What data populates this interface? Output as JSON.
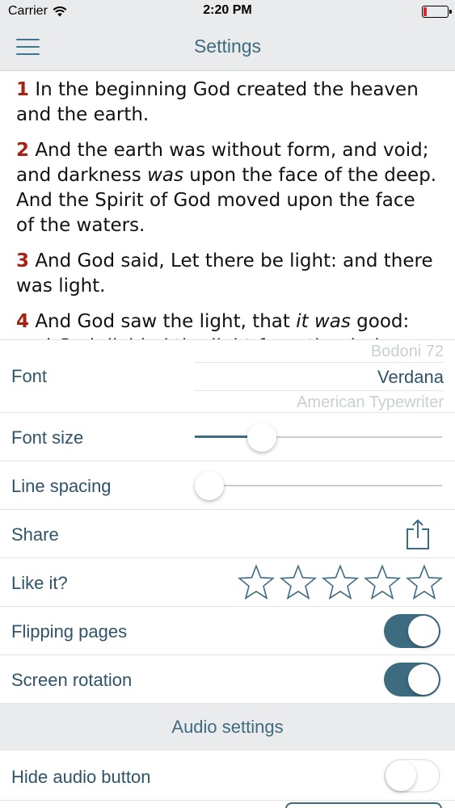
{
  "status_bar": {
    "carrier": "Carrier",
    "time": "2:20 PM",
    "battery_color": "#e0242b"
  },
  "nav": {
    "title": "Settings",
    "menu_icon": "hamburger-menu-icon"
  },
  "preview": {
    "verses": [
      {
        "num": "1",
        "parts": [
          {
            "t": "In the beginning God created the heaven and the earth."
          }
        ]
      },
      {
        "num": "2",
        "parts": [
          {
            "t": "And the earth was without form, and void; and darkness "
          },
          {
            "t": "was",
            "i": true
          },
          {
            "t": " upon the face of the deep. And the Spirit of God moved upon the face of the waters."
          }
        ]
      },
      {
        "num": "3",
        "parts": [
          {
            "t": "And God said, Let there be light: and there was light."
          }
        ]
      },
      {
        "num": "4",
        "parts": [
          {
            "t": "And God saw the light, that "
          },
          {
            "t": "it was",
            "i": true
          },
          {
            "t": " good: and God divided the light from the darkness."
          }
        ]
      }
    ]
  },
  "settings": {
    "font": {
      "label": "Font",
      "options": [
        "Bodoni 72",
        "Verdana",
        "American Typewriter"
      ],
      "selected": "Verdana"
    },
    "font_size": {
      "label": "Font size",
      "value": 0.24
    },
    "line_spacing": {
      "label": "Line spacing",
      "value": 0.0
    },
    "share": {
      "label": "Share",
      "icon": "share-icon"
    },
    "like": {
      "label": "Like it?",
      "rating": 0,
      "max": 5,
      "icon": "star-outline-icon"
    },
    "flipping_pages": {
      "label": "Flipping pages",
      "on": true
    },
    "screen_rotation": {
      "label": "Screen rotation",
      "on": true
    },
    "audio_header": "Audio settings",
    "hide_audio": {
      "label": "Hide audio button",
      "on": false
    }
  },
  "colors": {
    "accent": "#3d6b80",
    "verse_number": "#a62213",
    "bar_background": "#e9ebec"
  }
}
